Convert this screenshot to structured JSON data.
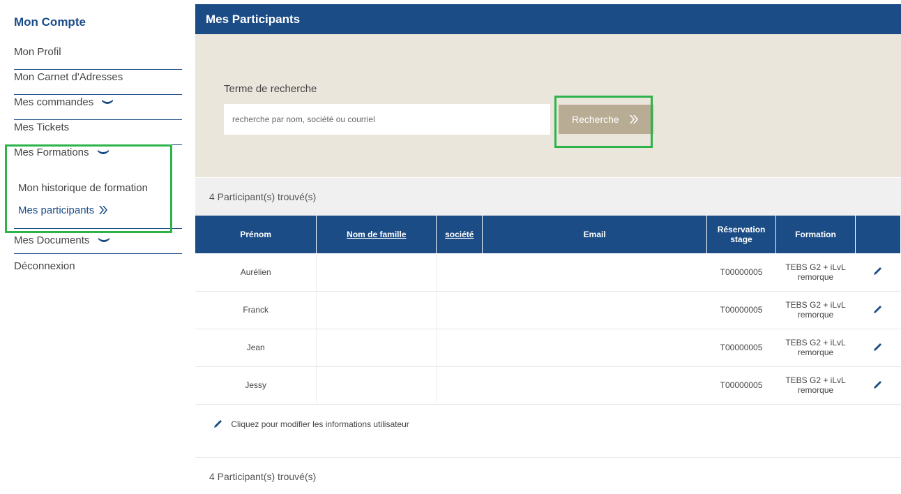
{
  "sidebar": {
    "title": "Mon Compte",
    "items": [
      {
        "label": "Mon Profil"
      },
      {
        "label": "Mon Carnet d'Adresses"
      },
      {
        "label": "Mes commandes"
      },
      {
        "label": "Mes Tickets"
      },
      {
        "label": "Mes Formations"
      },
      {
        "label": "Mes Documents"
      },
      {
        "label": "Déconnexion"
      }
    ],
    "sub_items": [
      {
        "label": "Mon historique de formation"
      },
      {
        "label": "Mes participants"
      }
    ]
  },
  "header": {
    "title": "Mes Participants"
  },
  "search": {
    "label": "Terme de recherche",
    "placeholder": "recherche par nom, société ou courriel",
    "value": "",
    "button_label": "Recherche"
  },
  "results": {
    "count_text": "4 Participant(s) trouvé(s)"
  },
  "table": {
    "headers": {
      "prenom": "Prénom",
      "nom": "Nom de famille",
      "societe": "société",
      "email": "Email",
      "reservation": "Réservation stage",
      "formation": "Formation"
    },
    "rows": [
      {
        "prenom": "Aurélien",
        "nom": "",
        "societe": "",
        "email": "",
        "reservation": "T00000005",
        "formation": "TEBS G2 + iLvL remorque"
      },
      {
        "prenom": "Franck",
        "nom": "",
        "societe": "",
        "email": "",
        "reservation": "T00000005",
        "formation": "TEBS G2 + iLvL remorque"
      },
      {
        "prenom": "Jean",
        "nom": "",
        "societe": "",
        "email": "",
        "reservation": "T00000005",
        "formation": "TEBS G2 + iLvL remorque"
      },
      {
        "prenom": "Jessy",
        "nom": "",
        "societe": "",
        "email": "",
        "reservation": "T00000005",
        "formation": "TEBS G2 + iLvL remorque"
      }
    ]
  },
  "edit_note": "Cliquez pour modifier les informations utilisateur",
  "icons": {
    "chevron": "chevron-down-icon",
    "double_chevron": "double-chevron-right-icon",
    "edit": "pencil-icon"
  },
  "colors": {
    "brand": "#1b4c86",
    "panel": "#ebe6dc",
    "button": "#b8ac94",
    "highlight": "#2db34a"
  }
}
